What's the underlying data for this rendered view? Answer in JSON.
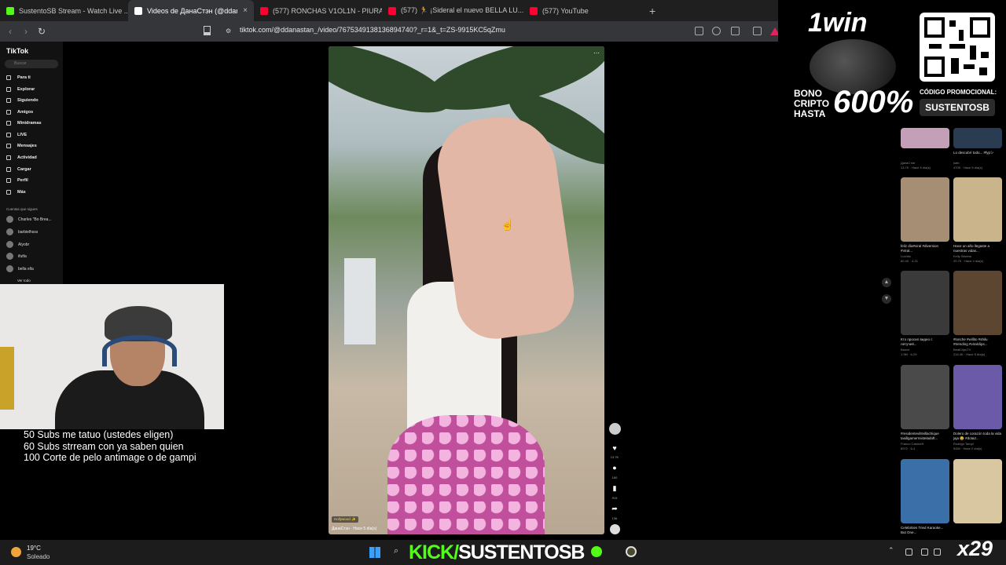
{
  "tabs": [
    {
      "label": "SustentoSB Stream - Watch Live ...",
      "icon_color": "#53fc18"
    },
    {
      "label": "Videos de ДанаСтэн (@ddanast...",
      "icon_color": "#ffffff"
    },
    {
      "label": "(577) RONCHAS V1OL1N - PIURANO",
      "icon_color": "#ff0033"
    },
    {
      "label": "(577) 🏃 ¡Sideral el nuevo BELLA LU...",
      "icon_color": "#ff0033"
    },
    {
      "label": "(577) YouTube",
      "icon_color": "#ff0033"
    }
  ],
  "tab_close": "×",
  "new_tab": "+",
  "address": {
    "url": "tiktok.com/@ddanastan_/video/7675349138136894740?_r=1&_t=ZS-9915KC5qZmu"
  },
  "tiktok": {
    "logo": "TikTok",
    "search_placeholder": "Buscar",
    "nav": [
      "Para ti",
      "Explorar",
      "Siguiendo",
      "Amigos",
      "Minidramas",
      "LIVE",
      "Mensajes",
      "Actividad",
      "Cargar",
      "Perfil",
      "Más"
    ],
    "following_header": "Cuentas que sigues",
    "following": [
      "Charles \"Bo Brea...",
      "barbielhsss",
      "Alyobr",
      "ifutfa",
      "bella ella"
    ],
    "see_all": "Ver todo",
    "video_caption": "ДанаСтэн · Hace 5 día(s)",
    "video_badge": "Hollywood ✨",
    "actions": {
      "likes": "13.7K",
      "comments": "160",
      "saves": "919",
      "shares": "136"
    }
  },
  "related": [
    {
      "caption": "",
      "author": "ДанаСтэн",
      "meta": "13.7K · Hace 5 día(s)",
      "color": "#c4a0b8"
    },
    {
      "caption": "Lo descubrí todo... #fypシ",
      "author": "katb",
      "meta": "470K · Hace 5 día(s)",
      "color": "#2a3c52"
    },
    {
      "caption": "feliz día#viral #diversion #Viral...",
      "author": "Luchito",
      "meta": "60.4K · 4-21",
      "color": "#a58e74"
    },
    {
      "caption": "Hace un año llegaste a nuestras vidas...",
      "author": "Kelly Stivens",
      "meta": "20.7K · Hace 4 día(s)",
      "color": "#c9b48c"
    },
    {
      "caption": "Кто просил видео с летучей...",
      "author": "Banve",
      "meta": "1.9M · 6-29",
      "color": "#3a3a3a"
    },
    {
      "caption": "#lonche #willito #shilu #trending #viralclips...",
      "author": "BeatClipsTV",
      "meta": "215.3K · Hace 5 día(s)",
      "color": "#5c4632"
    },
    {
      "caption": "#residentevil8villachique tasillgamermisteladoft...",
      "author": "Franco CastroHt",
      "meta": "8972 · 6-4",
      "color": "#4a4a4a"
    },
    {
      "caption": "Dolero de corazón toda la vida jaja 😂 #dota2...",
      "author": "Rodrigo Tampi",
      "meta": "5450 · Hace 2 día(s)",
      "color": "#6a5aa8"
    },
    {
      "caption": "Celebrities Tried Karaoke... But One...",
      "author": "",
      "meta": "",
      "color": "#3b6fa8"
    },
    {
      "caption": "",
      "author": "",
      "meta": "",
      "color": "#d8c7a0"
    }
  ],
  "ad": {
    "brand": "1win",
    "bono_text": "BONO CRIPTO HASTA",
    "percent": "600%",
    "code_label": "CÓDIGO PROMOCIONAL:",
    "code": "SUSTENTOSB"
  },
  "stream_goals": [
    "50 Subs me tatuo (ustedes eligen)",
    "60 Subs strream con ya saben quien",
    "100 Corte de pelo antimage o de gampi"
  ],
  "taskbar": {
    "temperature": "19°C",
    "weather": "Soleado",
    "kick_brand": "KICK/",
    "kick_channel": "SUSTENTOSB",
    "multiplier": "x29"
  }
}
